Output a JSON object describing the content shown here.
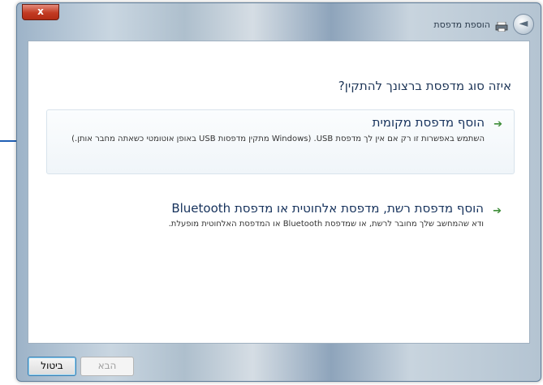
{
  "window": {
    "title": "הוספת מדפסת",
    "close_label": "x"
  },
  "content": {
    "question": "איזה סוג מדפסת ברצונך להתקין?",
    "options": [
      {
        "arrow": "➔",
        "title": "הוסף מדפסת מקומית",
        "description": "השתמש באפשרות זו רק אם אין לך מדפסת USB. (Windows מתקין מדפסות USB באופן אוטומטי כשאתה מחבר אותן.)"
      },
      {
        "arrow": "➔",
        "title": "הוסף מדפסת רשת, מדפסת אלחוטית או מדפסת Bluetooth",
        "description": "ודא שהמחשב שלך מחובר לרשת, או שמדפסת Bluetooth או המדפסת האלחוטית מופעלת."
      }
    ]
  },
  "footer": {
    "cancel_label": "ביטול",
    "next_label": "הבא"
  },
  "icons": {
    "back": "back-arrow-icon",
    "printer": "printer-icon",
    "option_arrow": "green-arrow-icon"
  },
  "colors": {
    "title_text": "#16325c",
    "arrow_green": "#3f8e3a",
    "close_red": "#c23a22",
    "annotation_blue": "#1f5fb4"
  }
}
